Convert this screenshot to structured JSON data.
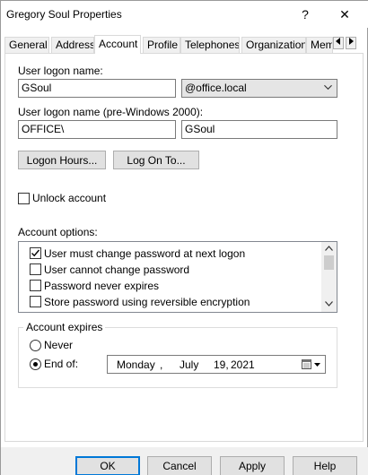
{
  "window": {
    "title": "Gregory Soul Properties",
    "help_label": "?",
    "close_label": "✕"
  },
  "tabs": [
    {
      "label": "General",
      "active": false
    },
    {
      "label": "Address",
      "active": false
    },
    {
      "label": "Account",
      "active": true
    },
    {
      "label": "Profile",
      "active": false
    },
    {
      "label": "Telephones",
      "active": false
    },
    {
      "label": "Organization",
      "active": false
    },
    {
      "label": "Mem",
      "active": false
    }
  ],
  "account": {
    "logon_name_label": "User logon name:",
    "logon_name_value": "GSoul",
    "domain_suffix": "@office.local",
    "pre2000_label": "User logon name (pre-Windows 2000):",
    "pre2000_domain": "OFFICE\\",
    "pre2000_name": "GSoul",
    "logon_hours_label": "Logon Hours...",
    "log_on_to_label": "Log On To...",
    "unlock_label": "Unlock account",
    "unlock_checked": false,
    "options_label": "Account options:",
    "options": [
      {
        "label": "User must change password at next logon",
        "checked": true
      },
      {
        "label": "User cannot change password",
        "checked": false
      },
      {
        "label": "Password never expires",
        "checked": false
      },
      {
        "label": "Store password using reversible encryption",
        "checked": false
      }
    ],
    "expires_group_label": "Account expires",
    "never_label": "Never",
    "end_of_label": "End of:",
    "selected_expiry": "end_of",
    "date": {
      "weekday": "Monday",
      "sep": ",",
      "month": "July",
      "day": "19,",
      "year": "2021"
    }
  },
  "footer": {
    "ok": "OK",
    "cancel": "Cancel",
    "apply": "Apply",
    "help": "Help"
  }
}
